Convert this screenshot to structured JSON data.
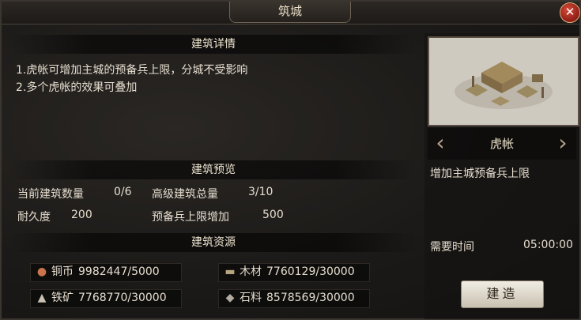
{
  "window": {
    "title": "筑城",
    "close_label": "✕"
  },
  "details": {
    "header": "建筑详情",
    "lines": [
      "1.虎帐可增加主城的预备兵上限，分城不受影响",
      "2.多个虎帐的效果可叠加"
    ]
  },
  "preview": {
    "header": "建筑预览",
    "current_count_label": "当前建筑数量",
    "current_count_value": "0/6",
    "advanced_total_label": "高级建筑总量",
    "advanced_total_value": "3/10",
    "durability_label": "耐久度",
    "durability_value": "200",
    "reserve_increase_label": "预备兵上限增加",
    "reserve_increase_value": "500"
  },
  "resources": {
    "header": "建筑资源",
    "items": [
      {
        "icon": "copper-coin-icon",
        "label": "铜币",
        "value": "9982447/5000"
      },
      {
        "icon": "wood-icon",
        "label": "木材",
        "value": "7760129/30000"
      },
      {
        "icon": "iron-ore-icon",
        "label": "铁矿",
        "value": "7768770/30000"
      },
      {
        "icon": "stone-icon",
        "label": "石料",
        "value": "8578569/30000"
      }
    ]
  },
  "building": {
    "name": "虎帐",
    "description": "增加主城预备兵上限",
    "time_label": "需要时间",
    "time_value": "05:00:00",
    "build_label": "建造"
  }
}
